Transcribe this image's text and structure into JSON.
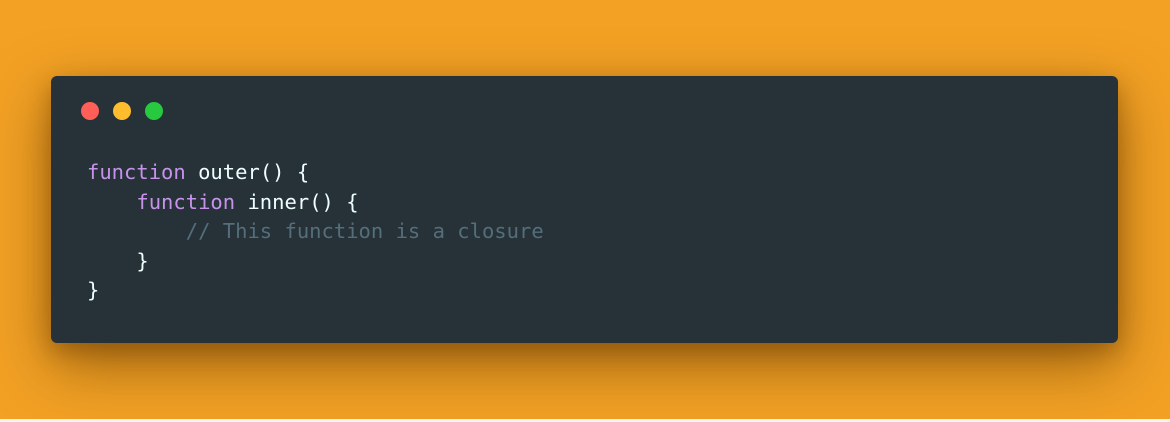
{
  "window": {
    "controls": [
      {
        "name": "close",
        "color": "#ff5f56"
      },
      {
        "name": "minimize",
        "color": "#ffbd2e"
      },
      {
        "name": "zoom",
        "color": "#27c93f"
      }
    ]
  },
  "code": {
    "lines": [
      {
        "indent": "",
        "keyword": "function",
        "name": " outer",
        "punct": "() {"
      },
      {
        "indent": "    ",
        "keyword": "function",
        "name": " inner",
        "punct": "() {"
      },
      {
        "indent": "        ",
        "comment": "// This function is a closure"
      },
      {
        "indent": "    ",
        "punct": "}"
      },
      {
        "indent": "",
        "punct": "}"
      }
    ]
  },
  "colors": {
    "background": "#f2a124",
    "window": "#263238",
    "keyword": "#c792ea",
    "text": "#eeffff",
    "comment": "#546e7a"
  }
}
